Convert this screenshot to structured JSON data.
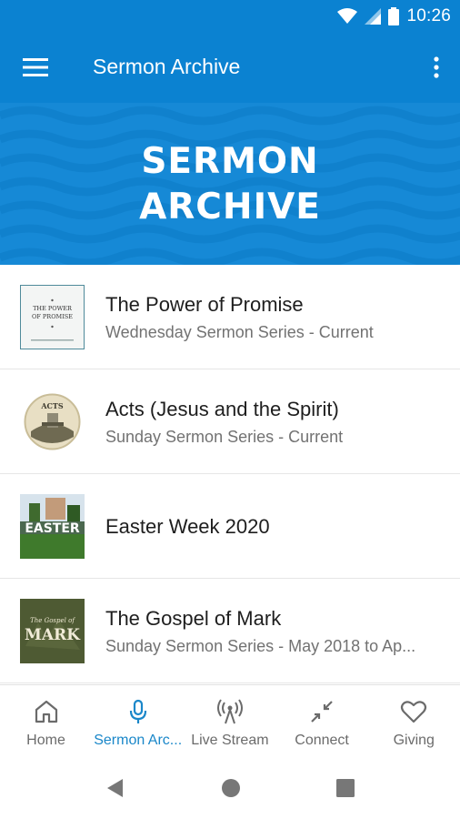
{
  "status_bar": {
    "time": "10:26",
    "icons": [
      "wifi-icon",
      "signal-icon",
      "battery-icon"
    ]
  },
  "app_bar": {
    "title": "Sermon Archive",
    "menu_icon": "hamburger-menu-icon",
    "overflow_icon": "more-vert-icon"
  },
  "banner": {
    "line1": "SERMON",
    "line2": "ARCHIVE"
  },
  "series": [
    {
      "title": "The Power of Promise",
      "subtitle": "Wednesday Sermon Series - Current",
      "thumb_line1": "THE POWER",
      "thumb_line2": "OF PROMISE"
    },
    {
      "title": "Acts (Jesus and the Spirit)",
      "subtitle": "Sunday Sermon Series - Current",
      "thumb_text": "ACTS"
    },
    {
      "title": "Easter Week 2020",
      "subtitle": "",
      "thumb_text": "EASTER"
    },
    {
      "title": "The Gospel of Mark",
      "subtitle": "Sunday Sermon Series - May 2018 to Ap...",
      "thumb_text": "MARK",
      "thumb_small": "The Gospel of"
    }
  ],
  "bottom_nav": [
    {
      "label": "Home",
      "icon": "home-icon",
      "active": false
    },
    {
      "label": "Sermon Arc...",
      "icon": "microphone-icon",
      "active": true
    },
    {
      "label": "Live Stream",
      "icon": "broadcast-icon",
      "active": false
    },
    {
      "label": "Connect",
      "icon": "connect-arrows-icon",
      "active": false
    },
    {
      "label": "Giving",
      "icon": "heart-icon",
      "active": false
    }
  ],
  "colors": {
    "primary": "#0b82d1",
    "banner": "#1689d6",
    "active_nav": "#1a87c9"
  }
}
